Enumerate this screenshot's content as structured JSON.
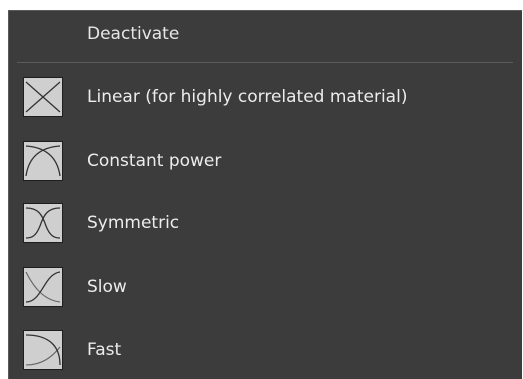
{
  "menu": {
    "header_label": "Deactivate",
    "items": [
      {
        "label": "Linear (for highly correlated material)",
        "icon": "linear-crossfade-icon"
      },
      {
        "label": "Constant power",
        "icon": "constant-power-crossfade-icon"
      },
      {
        "label": "Symmetric",
        "icon": "symmetric-crossfade-icon"
      },
      {
        "label": "Slow",
        "icon": "slow-crossfade-icon"
      },
      {
        "label": "Fast",
        "icon": "fast-crossfade-icon"
      }
    ]
  },
  "colors": {
    "menu_background": "#3c3c3c",
    "icon_background": "#cfcfcf",
    "curve_stroke": "#333333",
    "text": "#ececec"
  }
}
